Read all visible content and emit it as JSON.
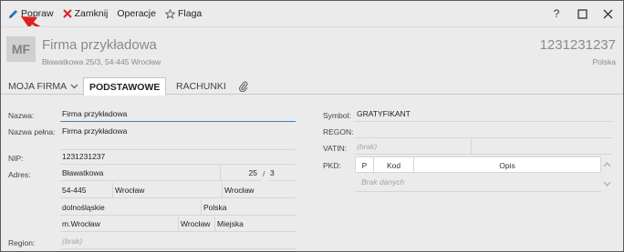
{
  "toolbar": {
    "popraw": "Popraw",
    "zamknij": "Zamknij",
    "operacje": "Operacje",
    "flaga": "Flaga",
    "help": "?"
  },
  "header": {
    "avatar": "MF",
    "company_name": "Firma przykładowa",
    "address": "Bławatkowa 25/3, 54-445 Wrocław",
    "code": "1231231237",
    "country": "Polska"
  },
  "tabs": {
    "moja_firma": "MOJA FIRMA",
    "podstawowe": "PODSTAWOWE",
    "rachunki": "RACHUNKI"
  },
  "form_left": {
    "nazwa_label": "Nazwa:",
    "nazwa_value": "Firma przykładowa",
    "nazwa_pelna_label": "Nazwa pełna:",
    "nazwa_pelna_value": "Firma przykładowa",
    "nip_label": "NIP:",
    "nip_value": "1231231237",
    "adres_label": "Adres:",
    "street": "Bławatkowa",
    "house": "25",
    "slash": "/",
    "flat": "3",
    "postal": "54-445",
    "post_city": "Wrocław",
    "city": "Wrocław",
    "voivodeship": "dolnośląskie",
    "country": "Polska",
    "gmina": "m.Wrocław",
    "county": "Wrocław",
    "area_type": "Miejska",
    "region_label": "Region:",
    "region_placeholder": "(brak)"
  },
  "form_right": {
    "symbol_label": "Symbol:",
    "symbol_value": "GRATYFIKANT",
    "regon_label": "REGON:",
    "vatin_label": "VATIN:",
    "vatin_placeholder": "(brak)",
    "pkd_label": "PKD:",
    "pkd_col_p": "P",
    "pkd_col_kod": "Kod",
    "pkd_col_opis": "Opis",
    "pkd_empty": "Brak danych"
  },
  "colors": {
    "popraw_icon": "#2a6fc9",
    "zamknij_icon": "#d9232a",
    "annotation_arrow": "#e02020"
  }
}
